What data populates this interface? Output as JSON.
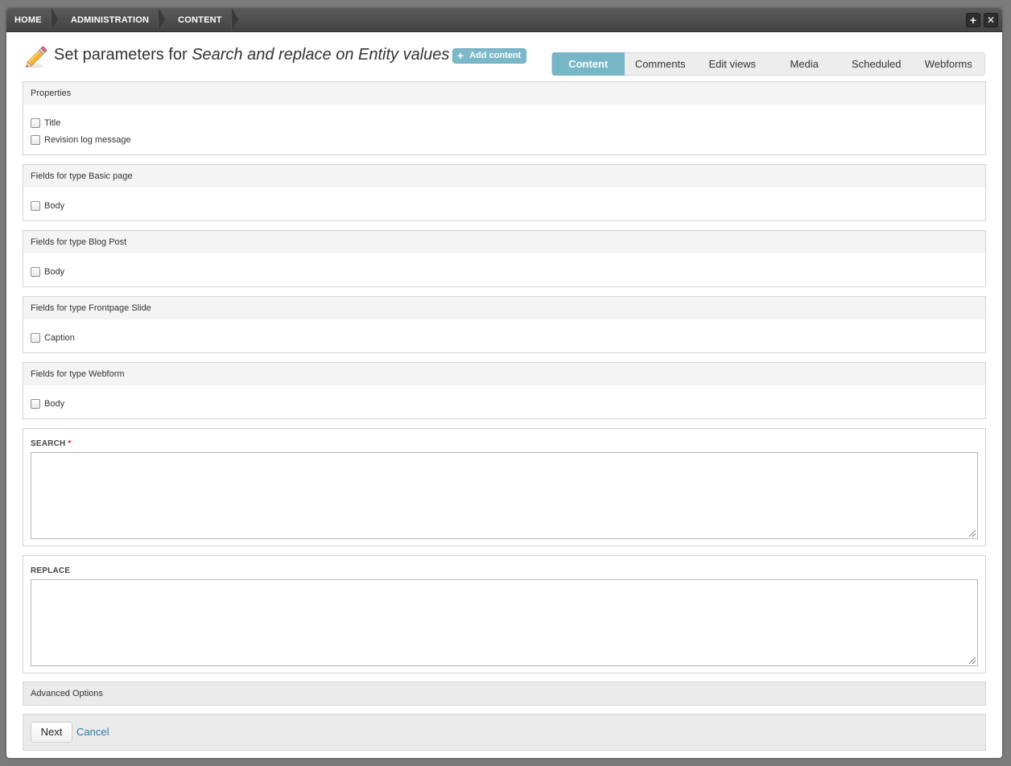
{
  "breadcrumb": [
    "HOME",
    "ADMINISTRATION",
    "CONTENT"
  ],
  "window_buttons": {
    "add": "+",
    "close": "✕"
  },
  "header": {
    "title_prefix": "Set parameters for ",
    "title_emphasis": "Search and replace on Entity values",
    "add_content_label": "Add content",
    "add_icon": "+"
  },
  "tabs": [
    {
      "label": "Content",
      "active": true
    },
    {
      "label": "Comments",
      "active": false
    },
    {
      "label": "Edit views",
      "active": false
    },
    {
      "label": "Media",
      "active": false
    },
    {
      "label": "Scheduled",
      "active": false
    },
    {
      "label": "Webforms",
      "active": false
    }
  ],
  "fieldsets": {
    "properties": {
      "legend": "Properties",
      "options": [
        "Title",
        "Revision log message"
      ]
    },
    "basic_page": {
      "legend": "Fields for type Basic page",
      "options": [
        "Body"
      ]
    },
    "blog_post": {
      "legend": "Fields for type Blog Post",
      "options": [
        "Body"
      ]
    },
    "frontpage_slide": {
      "legend": "Fields for type Frontpage Slide",
      "options": [
        "Caption"
      ]
    },
    "webform": {
      "legend": "Fields for type Webform",
      "options": [
        "Body"
      ]
    }
  },
  "search": {
    "label": "SEARCH",
    "required_mark": "*",
    "value": ""
  },
  "replace": {
    "label": "REPLACE",
    "value": ""
  },
  "advanced": {
    "label": "Advanced Options"
  },
  "actions": {
    "next_label": "Next",
    "cancel_label": "Cancel"
  },
  "colors": {
    "accent": "#76b6c6",
    "link": "#2a7ba8",
    "topbar": "#4a4a4a"
  }
}
